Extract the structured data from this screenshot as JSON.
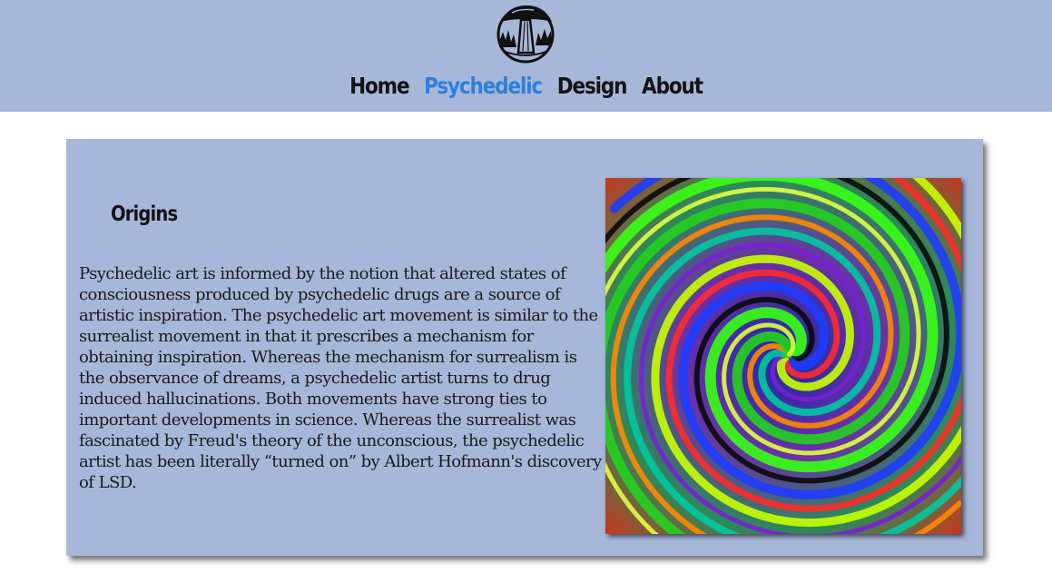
{
  "header": {
    "logo_icon": "mushroom-logo-icon",
    "nav": [
      {
        "label": "Home",
        "active": false
      },
      {
        "label": "Psychedelic",
        "active": true
      },
      {
        "label": "Design",
        "active": false
      },
      {
        "label": "About",
        "active": false
      }
    ]
  },
  "content": {
    "heading": "Origins",
    "paragraph": "Psychedelic art is informed by the notion that altered states of consciousness produced by psychedelic drugs are a source of artistic inspiration. The psychedelic art movement is similar to the surrealist movement in that it prescribes a mechanism for obtaining inspiration. Whereas the mechanism for surrealism is the observance of dreams, a psychedelic artist turns to drug induced hallucinations. Both movements have strong ties to important developments in science. Whereas the surrealist was fascinated by Freud's theory of the unconscious, the psychedelic artist has been literally “turned on” by Albert Hofmann's discovery of LSD.",
    "image_icon": "psychedelic-spiral-image"
  },
  "colors": {
    "header_bg": "#a7b7d9",
    "card_bg": "#a7b7d9",
    "nav_text": "#141414",
    "nav_active": "#2f7fdb"
  }
}
